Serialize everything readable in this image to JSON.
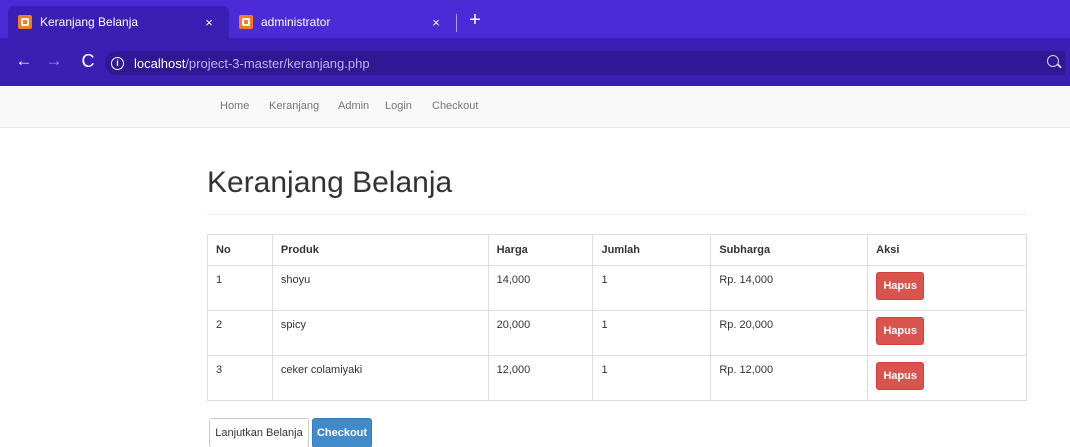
{
  "browser": {
    "tabs": [
      {
        "title": "Keranjang Belanja",
        "close": "×"
      },
      {
        "title": "administrator",
        "close": "×"
      }
    ],
    "new_tab": "+",
    "url_host": "localhost",
    "url_path": "/project-3-master/keranjang.php",
    "icons": {
      "back": "←",
      "forward": "→",
      "reload": "C",
      "info": "i"
    }
  },
  "navbar": {
    "links": [
      "Home",
      "Keranjang",
      "Admin",
      "Login",
      "Checkout"
    ]
  },
  "page": {
    "title": "Keranjang Belanja"
  },
  "table": {
    "headers": [
      "No",
      "Produk",
      "Harga",
      "Jumlah",
      "Subharga",
      "Aksi"
    ],
    "rows": [
      {
        "no": "1",
        "produk": "shoyu",
        "harga": "14,000",
        "jumlah": "1",
        "subharga": "Rp. 14,000",
        "aksi": "Hapus"
      },
      {
        "no": "2",
        "produk": "spicy",
        "harga": "20,000",
        "jumlah": "1",
        "subharga": "Rp. 20,000",
        "aksi": "Hapus"
      },
      {
        "no": "3",
        "produk": "ceker colamiyaki",
        "harga": "12,000",
        "jumlah": "1",
        "subharga": "Rp. 12,000",
        "aksi": "Hapus"
      }
    ]
  },
  "actions": {
    "continue_label": "Lanjutkan Belanja",
    "checkout_label": "Checkout"
  },
  "colors": {
    "browser_tabbar": "#4b2bd6",
    "browser_toolbar": "#3a1fb5",
    "danger": "#d9534f",
    "primary": "#428bca"
  }
}
